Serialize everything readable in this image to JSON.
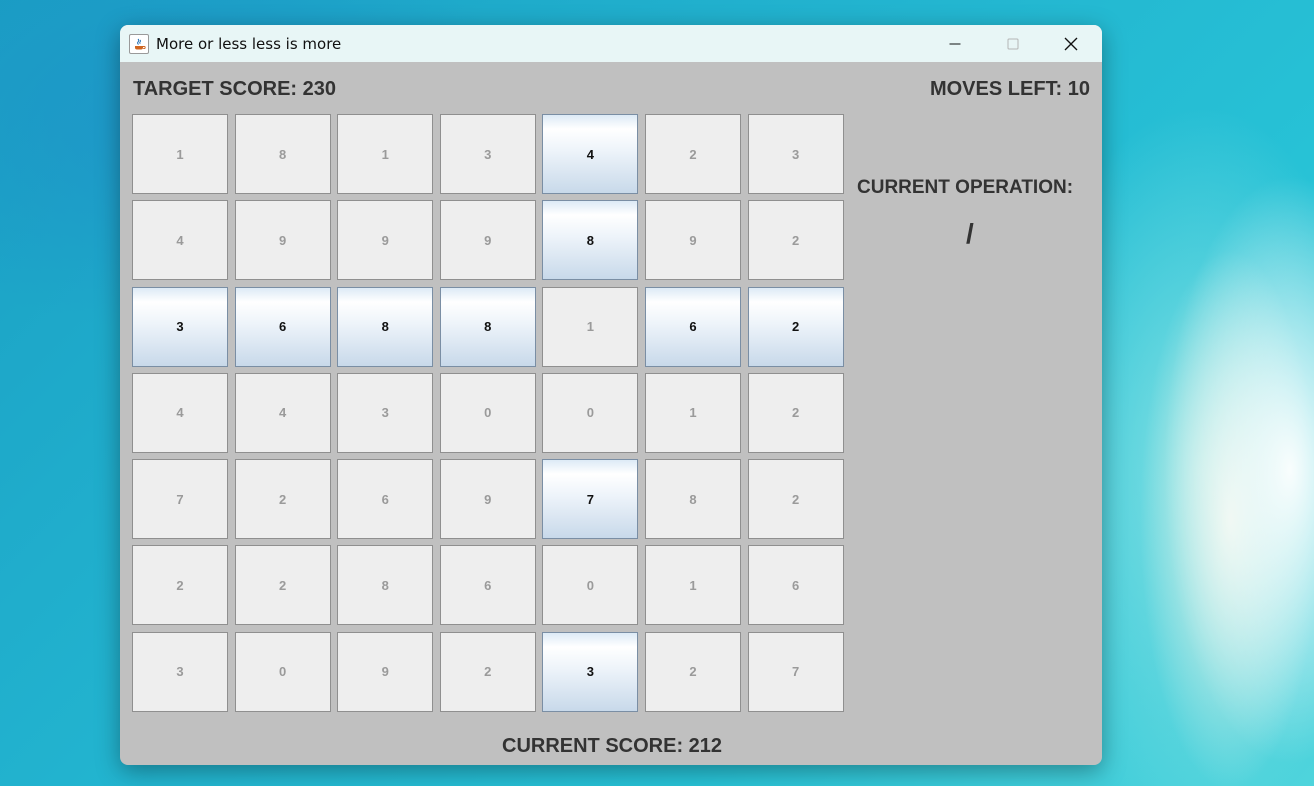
{
  "window": {
    "title": "More or less less is more"
  },
  "game": {
    "target_score": "TARGET SCORE: 230",
    "moves_left": "MOVES LEFT: 10",
    "current_operation_label": "CURRENT OPERATION:",
    "current_operation": "/",
    "current_score": "CURRENT SCORE: 212"
  },
  "grid": {
    "rows": [
      [
        {
          "v": "1",
          "s": false
        },
        {
          "v": "8",
          "s": false
        },
        {
          "v": "1",
          "s": false
        },
        {
          "v": "3",
          "s": false
        },
        {
          "v": "4",
          "s": true
        },
        {
          "v": "2",
          "s": false
        },
        {
          "v": "3",
          "s": false
        }
      ],
      [
        {
          "v": "4",
          "s": false
        },
        {
          "v": "9",
          "s": false
        },
        {
          "v": "9",
          "s": false
        },
        {
          "v": "9",
          "s": false
        },
        {
          "v": "8",
          "s": true
        },
        {
          "v": "9",
          "s": false
        },
        {
          "v": "2",
          "s": false
        }
      ],
      [
        {
          "v": "3",
          "s": true
        },
        {
          "v": "6",
          "s": true
        },
        {
          "v": "8",
          "s": true
        },
        {
          "v": "8",
          "s": true
        },
        {
          "v": "1",
          "s": false
        },
        {
          "v": "6",
          "s": true
        },
        {
          "v": "2",
          "s": true
        }
      ],
      [
        {
          "v": "4",
          "s": false
        },
        {
          "v": "4",
          "s": false
        },
        {
          "v": "3",
          "s": false
        },
        {
          "v": "0",
          "s": false
        },
        {
          "v": "0",
          "s": false
        },
        {
          "v": "1",
          "s": false
        },
        {
          "v": "2",
          "s": false
        }
      ],
      [
        {
          "v": "7",
          "s": false
        },
        {
          "v": "2",
          "s": false
        },
        {
          "v": "6",
          "s": false
        },
        {
          "v": "9",
          "s": false
        },
        {
          "v": "7",
          "s": true
        },
        {
          "v": "8",
          "s": false
        },
        {
          "v": "2",
          "s": false
        }
      ],
      [
        {
          "v": "2",
          "s": false
        },
        {
          "v": "2",
          "s": false
        },
        {
          "v": "8",
          "s": false
        },
        {
          "v": "6",
          "s": false
        },
        {
          "v": "0",
          "s": false
        },
        {
          "v": "1",
          "s": false
        },
        {
          "v": "6",
          "s": false
        }
      ],
      [
        {
          "v": "3",
          "s": false
        },
        {
          "v": "0",
          "s": false
        },
        {
          "v": "9",
          "s": false
        },
        {
          "v": "2",
          "s": false
        },
        {
          "v": "3",
          "s": true
        },
        {
          "v": "2",
          "s": false
        },
        {
          "v": "7",
          "s": false
        }
      ]
    ]
  }
}
